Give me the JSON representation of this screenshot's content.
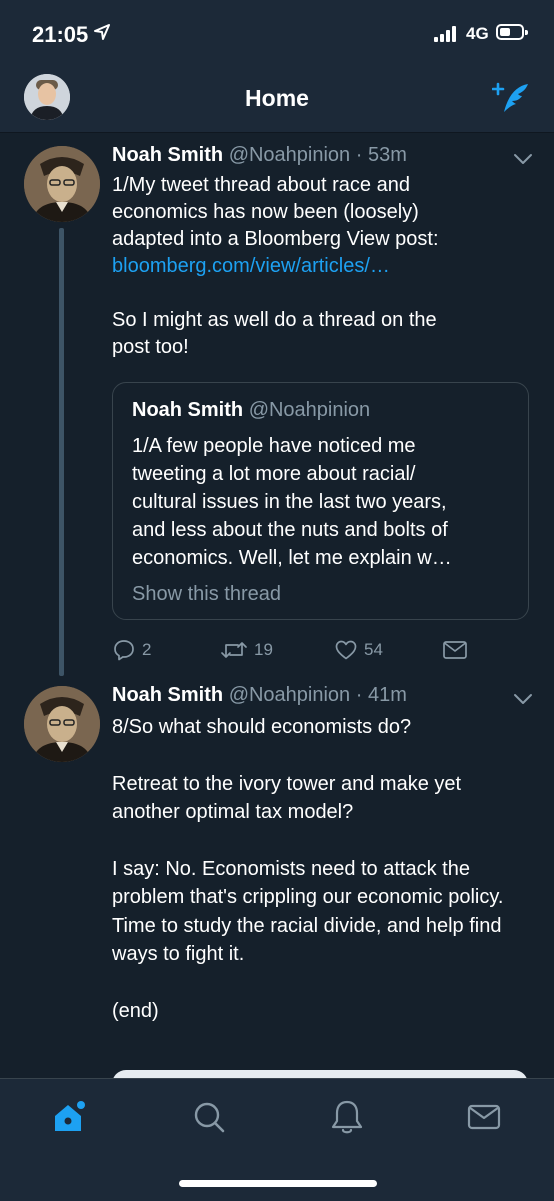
{
  "status_bar": {
    "time": "21:05",
    "network": "4G",
    "signal_bars": 4,
    "battery_level": 0.35
  },
  "nav": {
    "title": "Home"
  },
  "tweets": [
    {
      "name": "Noah Smith",
      "handle": "@Noahpinion",
      "time": "· 53m",
      "lines": [
        "1/My tweet thread about race and",
        "economics has now been (loosely)",
        "adapted into a Bloomberg View post:"
      ],
      "link": "bloomberg.com/view/articles/…",
      "lines2": [
        "So I might as well do a thread on the",
        "post too!"
      ],
      "quote": {
        "name": "Noah Smith",
        "handle": "@Noahpinion",
        "lines": [
          "1/A few people have noticed me",
          "tweeting a lot more about racial/",
          "cultural issues in the last two years,",
          "and less about the nuts and bolts of",
          "economics. Well, let me explain w…"
        ],
        "show_thread": "Show this thread"
      },
      "actions": {
        "replies": "2",
        "retweets": "19",
        "likes": "54"
      }
    },
    {
      "name": "Noah Smith",
      "handle": "@Noahpinion",
      "time": "· 41m",
      "paragraphs": [
        "8/So what should economists do?",
        "Retreat to the ivory tower and make yet another optimal tax model?",
        "I say: No. Economists need to attack the problem that's crippling our economic policy. Time to study the racial divide, and help find ways to fight it.",
        "(end)"
      ]
    }
  ],
  "colors": {
    "background": "#15202b",
    "bar": "#1c2938",
    "accent": "#1da1f2",
    "muted": "#8899a6",
    "border": "#38444d"
  },
  "tabs": [
    "home-icon",
    "search-icon",
    "notifications-icon",
    "messages-icon"
  ]
}
